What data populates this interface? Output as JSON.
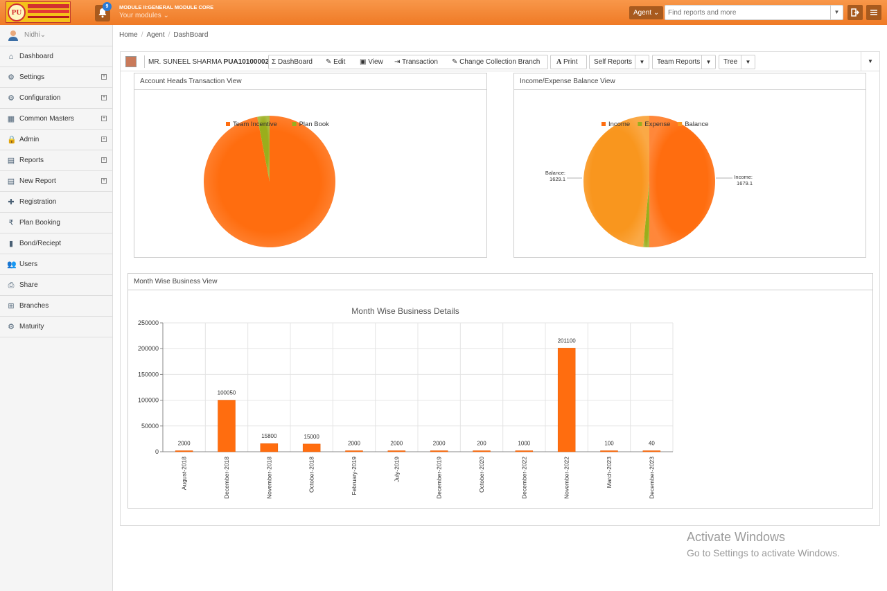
{
  "header": {
    "module_title": "MODULE II:GENERAL MODULE CORE",
    "your_modules": "Your modules ⌄",
    "notification_count": "9",
    "agent_label": "Agent ⌄",
    "search_placeholder": "Find reports and more",
    "accent": "#f08a3c"
  },
  "sidebar": {
    "user": "Nidhi⌄",
    "items": [
      {
        "label": "Dashboard",
        "icon": "home-icon",
        "glyph": "⌂",
        "expand": false
      },
      {
        "label": "Settings",
        "icon": "gear-icon",
        "glyph": "⚙",
        "expand": true
      },
      {
        "label": "Configuration",
        "icon": "gear-icon",
        "glyph": "⚙",
        "expand": true
      },
      {
        "label": "Common Masters",
        "icon": "grid-icon",
        "glyph": "▦",
        "expand": true
      },
      {
        "label": "Admin",
        "icon": "lock-icon",
        "glyph": "🔒",
        "expand": true
      },
      {
        "label": "Reports",
        "icon": "report-icon",
        "glyph": "▤",
        "expand": true
      },
      {
        "label": "New Report",
        "icon": "report-icon",
        "glyph": "▤",
        "expand": true
      },
      {
        "label": "Registration",
        "icon": "plus-icon",
        "glyph": "✚",
        "expand": false
      },
      {
        "label": "Plan Booking",
        "icon": "rupee-icon",
        "glyph": "₹",
        "expand": false
      },
      {
        "label": "Bond/Reciept",
        "icon": "document-icon",
        "glyph": "▮",
        "expand": false
      },
      {
        "label": "Users",
        "icon": "users-icon",
        "glyph": "👥",
        "expand": false
      },
      {
        "label": "Share",
        "icon": "print-icon",
        "glyph": "⎙",
        "expand": false
      },
      {
        "label": "Branches",
        "icon": "sitemap-icon",
        "glyph": "⊞",
        "expand": false
      },
      {
        "label": "Maturity",
        "icon": "gear-icon",
        "glyph": "⚙",
        "expand": false
      }
    ]
  },
  "breadcrumb": [
    "Home",
    "Agent",
    "DashBoard"
  ],
  "toolbar": {
    "customer_name": "MR. SUNEEL SHARMA",
    "customer_id": "PUA10100002",
    "buttons": [
      "DashBoard",
      "Edit",
      "View",
      "Transaction",
      "Change Collection Branch"
    ],
    "print": "Print",
    "self_reports": "Self Reports",
    "team_reports": "Team Reports",
    "tree": "Tree"
  },
  "panels": {
    "account_heads": "Account Heads Transaction View",
    "income_expense": "Income/Expense Balance View",
    "month_wise": "Month Wise Business View"
  },
  "chart_data": [
    {
      "type": "pie",
      "title": "",
      "legend_position": "top",
      "slices": [
        {
          "label": "Team Incentive",
          "value": 97,
          "color": "#ff6d0f"
        },
        {
          "label": "Plan Book",
          "value": 3,
          "color": "#9aae1c"
        }
      ]
    },
    {
      "type": "pie",
      "title": "",
      "legend_position": "top",
      "slices": [
        {
          "label": "Income",
          "value": 1679.1,
          "color": "#ff6d0f",
          "data_label": "Income: 1679.1"
        },
        {
          "label": "Expense",
          "value": 50,
          "color": "#9aae1c"
        },
        {
          "label": "Balance",
          "value": 1629.1,
          "color": "#f9961e",
          "data_label": "Balance: 1629.1"
        }
      ]
    },
    {
      "type": "bar",
      "title": "Month Wise Business Details",
      "xlabel": "",
      "ylabel": "",
      "ylim": [
        0,
        250000
      ],
      "yticks": [
        0,
        50000,
        100000,
        150000,
        200000,
        250000
      ],
      "grid": true,
      "categories": [
        "August-2018",
        "December-2018",
        "November-2018",
        "October-2018",
        "February-2019",
        "July-2019",
        "December-2019",
        "October-2020",
        "December-2022",
        "November-2022",
        "March-2023",
        "December-2023"
      ],
      "values": [
        2000,
        100050,
        15800,
        15000,
        2000,
        2000,
        2000,
        200,
        1000,
        201100,
        100,
        40
      ],
      "color": "#ff6d0f"
    }
  ],
  "watermark": {
    "line1": "Activate Windows",
    "line2": "Go to Settings to activate Windows."
  }
}
